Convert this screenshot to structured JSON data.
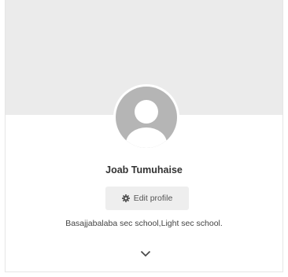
{
  "profile": {
    "name": "Joab Tumuhaise",
    "edit_label": "Edit profile",
    "bio": "Basajjabalaba sec school,Light sec school."
  },
  "icons": {
    "avatar": "default-user-avatar-icon",
    "edit": "gear-icon",
    "expand": "chevron-down-icon"
  },
  "colors": {
    "cover": "#ebebeb",
    "avatar_bg": "#b5b5b5",
    "button_bg": "#eeeeee"
  }
}
